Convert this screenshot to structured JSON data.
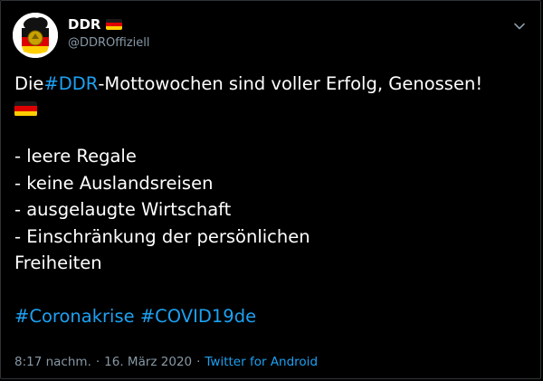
{
  "tweet": {
    "author_name": "DDR",
    "author_handle": "@DDROffiziell",
    "lines": {
      "l1_pre": "Die ",
      "l1_tag": "#DDR",
      "l1_post": "-Mottowochen sind voller Erfolg, Genossen!",
      "l3": "- leere Regale",
      "l4": "- keine Auslandsreisen",
      "l5": "- ausgelaugte Wirtschaft",
      "l6": "- Einschränkung der persönlichen",
      "l7": "Freiheiten",
      "tag1": "#Coronakrise",
      "tag2": "#COVID19de"
    },
    "time": "8:17 nachm.",
    "separator": "·",
    "date": "16. März 2020",
    "source": "Twitter for Android"
  },
  "icons": {
    "avatar": "ddr-emblem-avatar",
    "flag": "german-flag-emoji",
    "menu": "chevron-down-icon"
  },
  "colors": {
    "background": "#000000",
    "text": "#ffffff",
    "secondary": "#8899a6",
    "link": "#1da1f2"
  }
}
